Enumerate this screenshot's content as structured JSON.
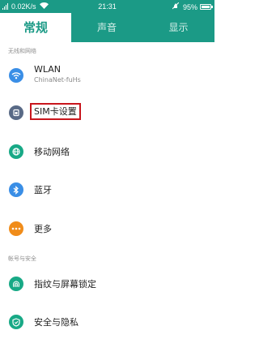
{
  "status_bar": {
    "speed": "0.02K/s",
    "time": "21:31",
    "battery": "95%",
    "icons": [
      "signal-icon",
      "wifi-icon",
      "mute-icon",
      "battery-icon"
    ]
  },
  "tabs": [
    {
      "label": "常规",
      "active": true
    },
    {
      "label": "声音",
      "active": false
    },
    {
      "label": "显示",
      "active": false
    }
  ],
  "sections": [
    {
      "header": "无线和网络"
    },
    {
      "header": "帐号与安全"
    }
  ],
  "items": [
    {
      "title": "WLAN",
      "subtitle": "ChinaNet-fuHs",
      "icon": "wifi-icon",
      "color": "#3a8ee6"
    },
    {
      "title": "SIM卡设置",
      "icon": "sim-card-icon",
      "color": "#596a86",
      "highlighted": true
    },
    {
      "title": "移动网络",
      "icon": "mobile-network-icon",
      "color": "#18a986"
    },
    {
      "title": "蓝牙",
      "icon": "bluetooth-icon",
      "color": "#3a8ee6"
    },
    {
      "title": "更多",
      "icon": "more-icon",
      "color": "#f08c1a"
    },
    {
      "title": "指纹与屏幕锁定",
      "icon": "fingerprint-icon",
      "color": "#18a986"
    },
    {
      "title": "安全与隐私",
      "icon": "shield-icon",
      "color": "#18a986"
    }
  ],
  "colors": {
    "accent": "#1b9a86",
    "highlight_border": "#c8161d"
  }
}
